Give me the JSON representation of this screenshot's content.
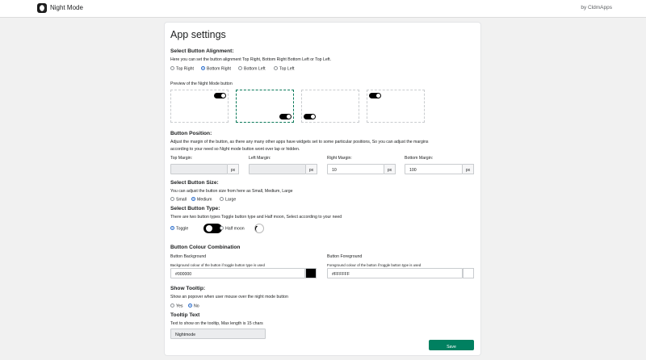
{
  "topbar": {
    "app_name": "Night Mode",
    "by": "by CldmApps"
  },
  "page_title": "App settings",
  "alignment": {
    "heading": "Select Button Alignment:",
    "description": "Here you can set the button alignment Top Right, Bottom Right Bottom Left or Top Left.",
    "options": [
      "Top Right",
      "Bottom Right",
      "Bottom Left",
      "Top Left"
    ],
    "selected": "Bottom Right",
    "preview_label": "Preview of the Night Mode button"
  },
  "position": {
    "heading": "Button Position:",
    "description_line1": "Adjust the margin of the button, as there any many other apps have widgets set to some particular positions, So you can adjust the margins",
    "description_line2": "according to your need so Night mode button wont over lap or hidden.",
    "top_label": "Top Margin:",
    "top_value": "",
    "left_label": "Left Margin:",
    "left_value": "",
    "right_label": "Right Margin:",
    "right_value": "10",
    "bottom_label": "Bottom Margin:",
    "bottom_value": "100",
    "unit": "px"
  },
  "size": {
    "heading": "Select Button Size:",
    "description": "You can adjust the button size from here as Small, Medium, Large",
    "options": [
      "Small",
      "Medium",
      "Large"
    ],
    "selected": "Medium"
  },
  "type": {
    "heading": "Select Button Type:",
    "description": "There are two button types Toggle button type and Half moon, Select according to your need",
    "options": [
      "Toggle",
      "Half moon"
    ],
    "selected": "Toggle"
  },
  "colour": {
    "heading": "Button Colour Combination",
    "bg_label": "Button Background",
    "bg_help": "Background colour of the button if toggle button type is used",
    "bg_value": "#000000",
    "fg_label": "Button Foreground",
    "fg_help": "Foreground colour of the button if toggle button type is used",
    "fg_value": "#FFFFFF"
  },
  "tooltip": {
    "heading": "Show Tooltip:",
    "description": "Show an popover when user mouse over the night mode button",
    "options": [
      "Yes",
      "No"
    ],
    "selected": "No",
    "text_heading": "Tooltip Text",
    "text_help": "Text to show on the tooltip, Max length is 15 chars",
    "text_value": "Nightmode"
  },
  "save_label": "Save"
}
